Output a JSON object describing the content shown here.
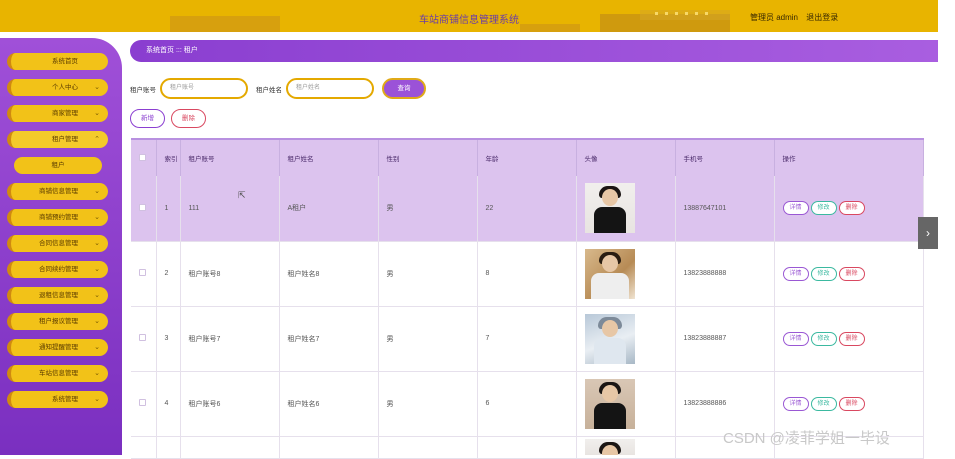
{
  "header": {
    "title": "车站商铺信息管理系统",
    "user_label": "管理员 admin",
    "logout": "退出登录"
  },
  "sidebar": {
    "items": [
      {
        "label": "系统首页",
        "chevron": false
      },
      {
        "label": "个人中心",
        "chevron": true
      },
      {
        "label": "商家管理",
        "chevron": true
      },
      {
        "label": "租户管理",
        "chevron": true,
        "open": true
      },
      {
        "label": "租户",
        "sub": true
      },
      {
        "label": "商铺信息管理",
        "chevron": true
      },
      {
        "label": "商铺预约管理",
        "chevron": true
      },
      {
        "label": "合同信息管理",
        "chevron": true
      },
      {
        "label": "合同续约管理",
        "chevron": true
      },
      {
        "label": "退租信息管理",
        "chevron": true
      },
      {
        "label": "租户报议管理",
        "chevron": true
      },
      {
        "label": "通知提醒管理",
        "chevron": true
      },
      {
        "label": "车站信息管理",
        "chevron": true
      },
      {
        "label": "系统管理",
        "chevron": true
      }
    ]
  },
  "breadcrumb": {
    "text": "系统首页 ::: 租户"
  },
  "search": {
    "account_label": "租户账号",
    "account_placeholder": "租户账号",
    "name_label": "租户姓名",
    "name_placeholder": "租户姓名",
    "query_button": "查询"
  },
  "actions": {
    "add": "新增",
    "delete": "删除"
  },
  "table": {
    "headers": [
      "",
      "索引",
      "租户账号",
      "租户姓名",
      "性别",
      "年龄",
      "头像",
      "手机号",
      "操作"
    ],
    "rows": [
      {
        "index": "1",
        "account": "111",
        "name": "A租户",
        "gender": "男",
        "age": "22",
        "phone": "13887647101",
        "avatar": "avatar-1"
      },
      {
        "index": "2",
        "account": "租户账号8",
        "name": "租户姓名8",
        "gender": "男",
        "age": "8",
        "phone": "13823888888",
        "avatar": "avatar-2"
      },
      {
        "index": "3",
        "account": "租户账号7",
        "name": "租户姓名7",
        "gender": "男",
        "age": "7",
        "phone": "13823888887",
        "avatar": "avatar-3"
      },
      {
        "index": "4",
        "account": "租户账号6",
        "name": "租户姓名6",
        "gender": "男",
        "age": "6",
        "phone": "13823888886",
        "avatar": "avatar-4"
      }
    ],
    "op_labels": {
      "detail": "详情",
      "edit": "修改",
      "delete": "删除"
    }
  },
  "watermark": "CSDN @凌菲学姐一毕设",
  "colors": {
    "topbar": "#e8b400",
    "sidebar": "#8a3ed0",
    "accent": "#9b52d8",
    "menu_item": "#f2c218"
  }
}
